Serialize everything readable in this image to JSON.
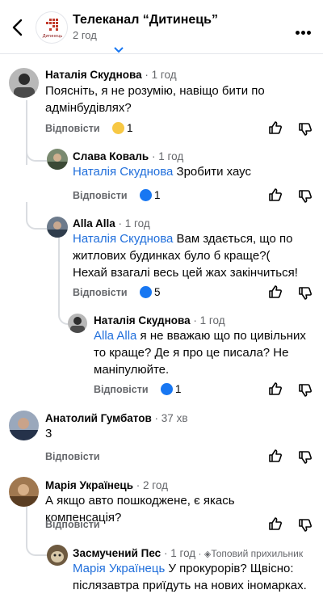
{
  "header": {
    "page_name": "Телеканал “Дитинець”",
    "time": "2 год",
    "logo_text": "Дитинець"
  },
  "comments": [
    {
      "author": "Наталія Скуднова",
      "time": "1 год",
      "mention": "",
      "text": "Поясніть, я не розумію, навіщо бити по адмінбудівлях?",
      "reply": "Відповісти",
      "reaction_count": "1"
    },
    {
      "author": "Слава Коваль",
      "time": "1 год",
      "mention": "Наталія Скуднова",
      "text": "Зробити хаус",
      "reply": "Відповісти",
      "reaction_count": "1"
    },
    {
      "author": "Alla Alla",
      "time": "1 год",
      "mention": "Наталія Скуднова",
      "text": "Вам здається, що по житлових будинках було б краще?( Нехай взагалі весь цей жах закінчиться!",
      "reply": "Відповісти",
      "reaction_count": "5"
    },
    {
      "author": "Наталія Скуднова",
      "time": "1 год",
      "mention": "Alla Alla",
      "text": "я не вважаю що по цивільних то краще? Де я про це писала? Не маніпулюйте.",
      "reply": "Відповісти",
      "reaction_count": "1"
    },
    {
      "author": "Анатолий Гумбатов",
      "time": "37 хв",
      "mention": "",
      "text": "3",
      "reply": "Відповісти",
      "reaction_count": ""
    },
    {
      "author": "Марія Українець",
      "time": "2 год",
      "mention": "",
      "text": "А якщо авто пошкоджене, є якась компенсація?",
      "reply": "Відповісти",
      "reaction_count": ""
    },
    {
      "author": "Засмучений Пес",
      "time": "1 год",
      "badge": "Топовий прихильник",
      "mention": "Марія Українець",
      "text": "У прокурорів? Щвісно: післязавтра приїдуть на нових іномарках.",
      "reply": "",
      "reaction_count": ""
    }
  ],
  "colors": {
    "link": "#216fdb",
    "like": "#1877f2",
    "muted": "#65676b",
    "thread": "#dadde1"
  }
}
